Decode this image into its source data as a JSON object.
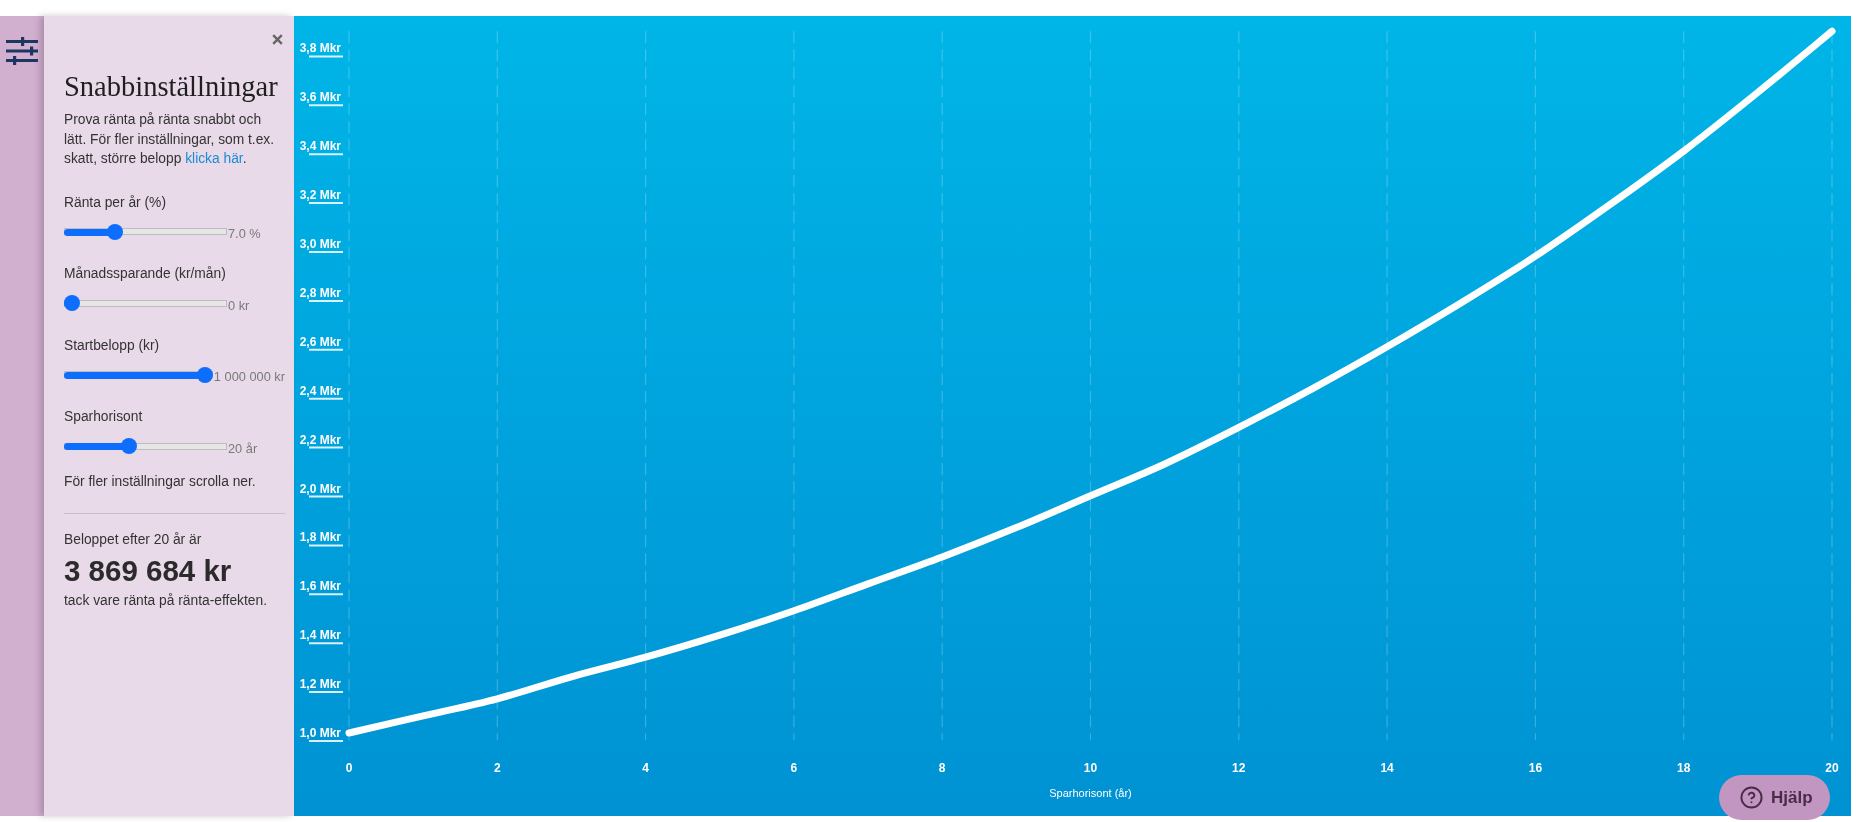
{
  "settings_panel": {
    "title": "Snabbinställningar",
    "intro": {
      "text": "Prova ränta på ränta snabbt och lätt. För fler inställningar, som t.ex. skatt, större belopp",
      "link": "klicka här",
      "after": "."
    },
    "sliders": [
      {
        "label": "Ränta per år (%)",
        "level": 0.29,
        "reading": "7.0 %"
      },
      {
        "label": "Månadssparande (kr/mån)",
        "level": 0,
        "reading": "0 kr"
      },
      {
        "label": "Startbelopp (kr)",
        "level": 1,
        "reading": "1 000 000 kr"
      },
      {
        "label": "Sparhorisont",
        "level": 0.39,
        "reading": "20 år"
      }
    ],
    "note": "För fler inställningar scrolla ner.",
    "result": {
      "caption": "Beloppet efter 20 år är",
      "amount": "3 869 684 kr",
      "footnote": "tack vare ränta på ränta-effekten."
    }
  },
  "chart": {
    "chart_data": {
      "type": "line",
      "xlabel": "Sparhorisont (år)",
      "x": [
        0,
        1,
        2,
        3,
        4,
        5,
        6,
        7,
        8,
        9,
        10,
        11,
        12,
        13,
        14,
        15,
        16,
        17,
        18,
        19,
        20
      ],
      "values": [
        1.0,
        1.07,
        1.14,
        1.23,
        1.31,
        1.4,
        1.5,
        1.61,
        1.72,
        1.84,
        1.97,
        2.1,
        2.25,
        2.41,
        2.58,
        2.76,
        2.95,
        3.16,
        3.38,
        3.62,
        3.87
      ],
      "xlim": [
        0,
        20
      ],
      "ylim": [
        0.97,
        3.87
      ],
      "grid": true,
      "xticks": [
        0,
        2,
        4,
        6,
        8,
        10,
        12,
        14,
        16,
        18,
        20
      ],
      "yticks": [
        {
          "value": 1.0,
          "label": "1,0 Mkr"
        },
        {
          "value": 1.2,
          "label": "1,2 Mkr"
        },
        {
          "value": 1.4,
          "label": "1,4 Mkr"
        },
        {
          "value": 1.6,
          "label": "1,6 Mkr"
        },
        {
          "value": 1.8,
          "label": "1,8 Mkr"
        },
        {
          "value": 2.0,
          "label": "2,0 Mkr"
        },
        {
          "value": 2.2,
          "label": "2,2 Mkr"
        },
        {
          "value": 2.4,
          "label": "2,4 Mkr"
        },
        {
          "value": 2.6,
          "label": "2,6 Mkr"
        },
        {
          "value": 2.8,
          "label": "2,8 Mkr"
        },
        {
          "value": 3.0,
          "label": "3,0 Mkr"
        },
        {
          "value": 3.2,
          "label": "3,2 Mkr"
        },
        {
          "value": 3.4,
          "label": "3,4 Mkr"
        },
        {
          "value": 3.6,
          "label": "3,6 Mkr"
        },
        {
          "value": 3.8,
          "label": "3,8 Mkr"
        }
      ]
    }
  },
  "help_button": {
    "label": "Hjälp"
  }
}
